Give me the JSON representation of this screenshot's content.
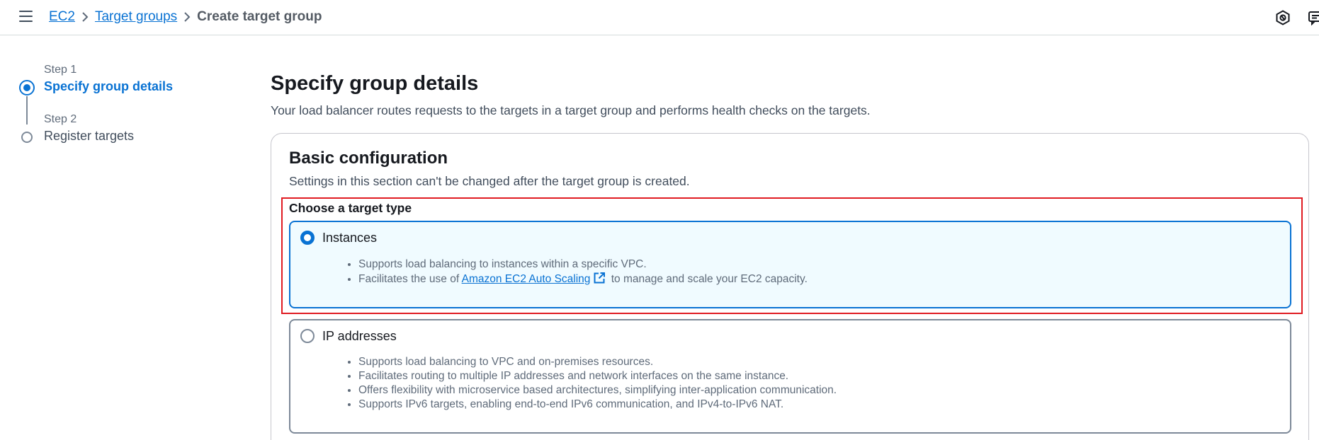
{
  "breadcrumb": {
    "items": [
      "EC2",
      "Target groups"
    ],
    "current": "Create target group"
  },
  "top_icons": [
    "settings-hex-icon",
    "feedback-icon"
  ],
  "stepper": {
    "steps": [
      {
        "caption": "Step 1",
        "title": "Specify group details",
        "state": "active"
      },
      {
        "caption": "Step 2",
        "title": "Register targets",
        "state": "inactive"
      }
    ]
  },
  "page": {
    "title": "Specify group details",
    "description": "Your load balancer routes requests to the targets in a target group and performs health checks on the targets."
  },
  "basic_config": {
    "title": "Basic configuration",
    "description": "Settings in this section can't be changed after the target group is created.",
    "target_type_label": "Choose a target type",
    "options": [
      {
        "label": "Instances",
        "selected": true,
        "bullets": [
          "Supports load balancing to instances within a specific VPC."
        ],
        "bullet2": {
          "prefix": "Facilitates the use of",
          "link": "Amazon EC2 Auto Scaling",
          "suffix": "to manage and scale your EC2 capacity."
        }
      },
      {
        "label": "IP addresses",
        "selected": false,
        "bullets": [
          "Supports load balancing to VPC and on-premises resources.",
          "Facilitates routing to multiple IP addresses and network interfaces on the same instance.",
          "Offers flexibility with microservice based architectures, simplifying inter-application communication.",
          "Supports IPv6 targets, enabling end-to-end IPv6 communication, and IPv4-to-IPv6 NAT."
        ]
      }
    ]
  },
  "colors": {
    "accent": "#0972d3",
    "highlight": "#e01b22",
    "selected_bg": "#f0fbff"
  }
}
